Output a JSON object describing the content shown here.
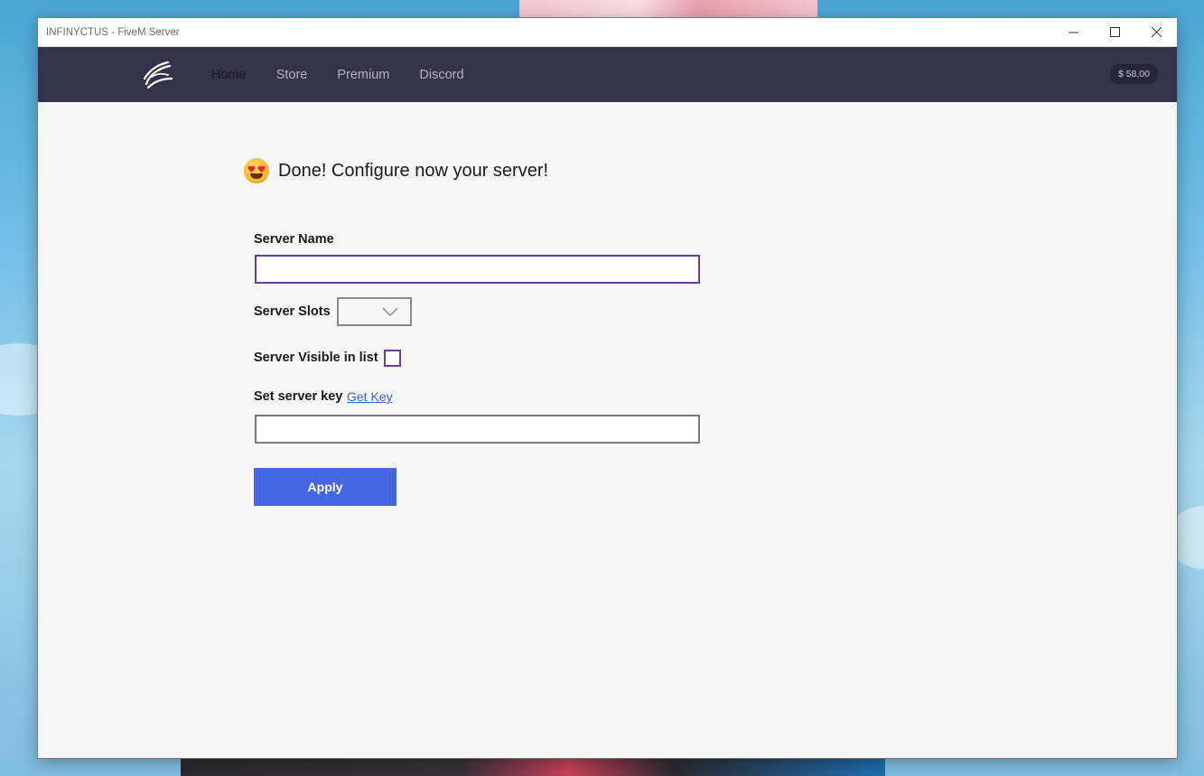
{
  "window": {
    "title": "INFINYCTUS - FiveM Server",
    "controls": [
      "minimize-icon",
      "maximize-icon",
      "close-icon"
    ]
  },
  "navbar": {
    "items": [
      {
        "label": "Home",
        "active": true
      },
      {
        "label": "Store",
        "active": false
      },
      {
        "label": "Premium",
        "active": false
      },
      {
        "label": "Discord",
        "active": false
      }
    ],
    "balance": "$ 58,00"
  },
  "main": {
    "heading": "Done! Configure now your server!",
    "heading_icon": "heart-eyes-emoji-icon",
    "server_name": {
      "label": "Server Name",
      "value": "",
      "placeholder": ""
    },
    "server_slots": {
      "label": "Server Slots",
      "value": ""
    },
    "server_visible": {
      "label": "Server Visible in list",
      "checked": false
    },
    "server_key": {
      "label": "Set server key",
      "link": "Get Key",
      "value": ""
    },
    "apply_label": "Apply"
  },
  "colors": {
    "navbar": "#35324c",
    "accent_purple": "#6a3d9a",
    "apply_button": "#4367de",
    "link": "#3a62c9"
  }
}
